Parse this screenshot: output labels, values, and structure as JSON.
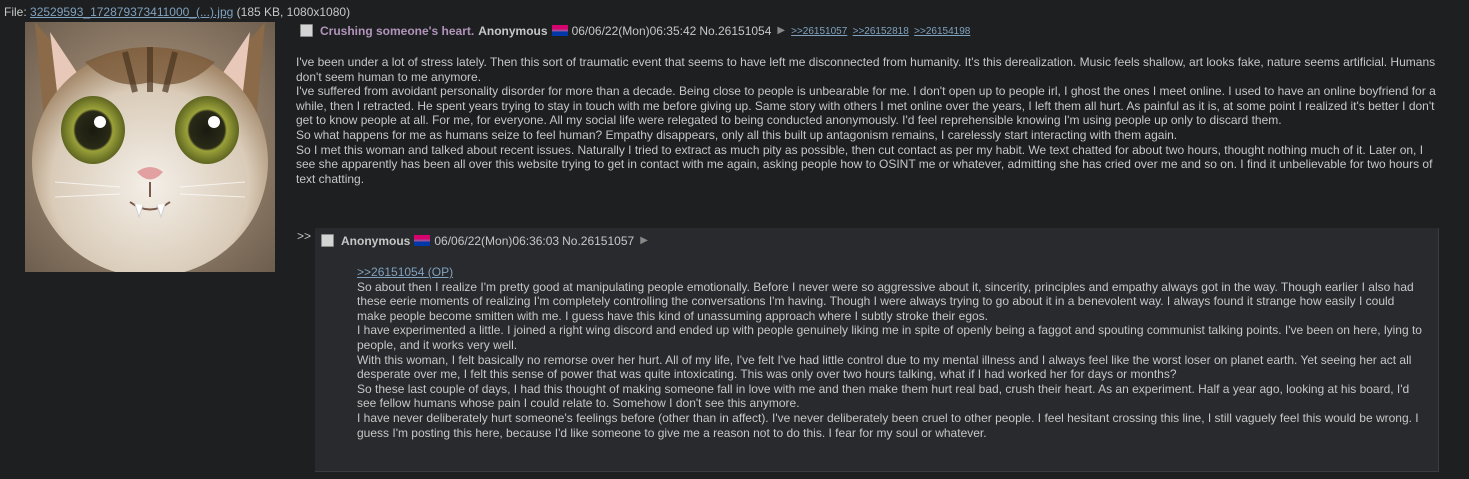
{
  "file": {
    "prefix": "File: ",
    "filename": "32529593_172879373411000_(...).jpg",
    "info": " (185 KB, 1080x1080)"
  },
  "colors": {
    "background": "#1d1f21",
    "reply_bg": "#282a2e",
    "subject": "#b294bb",
    "link": "#81a2be",
    "text": "#c5c8c6"
  },
  "op": {
    "subject": "Crushing someone's heart.",
    "name": "Anonymous",
    "flag_icon": "bisexual-flag-icon",
    "datetime": "06/06/22(Mon)06:35:42",
    "post_no": "No.26151054",
    "menu_icon": "triangle-right-icon",
    "backlinks": [
      ">>26151057",
      ">>26152818",
      ">>26154198"
    ],
    "body": [
      "I've been under a lot of stress lately. Then this sort of traumatic event that seems to have left me disconnected from humanity. It's this derealization. Music feels shallow, art looks fake, nature seems artificial. Humans don't seem human to me anymore.",
      "I've suffered from avoidant personality disorder for more than a decade. Being close to people is unbearable for me. I don't open up to people irl, I ghost the ones I meet online. I used to have an online boyfriend for a while, then I retracted. He spent years trying to stay in touch with me before giving up. Same story with others I met online over the years, I left them all hurt. As painful as it is, at some point I realized it's better I don't get to know people at all. For me, for everyone. All my social life were relegated to being conducted anonymously. I'd feel reprehensible knowing I'm using people up only to discard them.",
      "So what happens for me as humans seize to feel human? Empathy disappears, only all this built up antagonism remains, I carelessly start interacting with them again.",
      "So I met this woman and talked about recent issues. Naturally I tried to extract as much pity as possible, then cut contact as per my habit. We text chatted for about two hours, thought nothing much of it. Later on, I see she apparently has been all over this website trying to get in contact with me again, asking people how to OSINT me or whatever, admitting she has cried over me and so on. I find it unbelievable for two hours of text chatting."
    ]
  },
  "reply": {
    "arrows": ">>",
    "name": "Anonymous",
    "flag_icon": "bisexual-flag-icon",
    "datetime": "06/06/22(Mon)06:36:03",
    "post_no": "No.26151057",
    "menu_icon": "triangle-right-icon",
    "quotelink": ">>26151054 (OP)",
    "body": [
      "So about then I realize I'm pretty good at manipulating people emotionally. Before I never were so aggressive about it, sincerity, principles and empathy always got in the way. Though earlier I also had these eerie moments of realizing I'm completely controlling the conversations I'm having. Though I were always trying to go about it in a benevolent way. I always found it strange how easily I could make people become smitten with me. I guess have this kind of unassuming approach where I subtly stroke their egos.",
      "I have experimented a little. I joined a right wing discord and ended up with people genuinely liking me in spite of openly being a faggot and spouting communist talking points. I've been on here, lying to people, and it works very well.",
      "With this woman, I felt basically no remorse over her hurt. All of my life, I've felt I've had little control due to my mental illness and I always feel like the worst loser on planet earth. Yet seeing her act all desperate over me, I felt this sense of power that was quite intoxicating. This was only over two hours talking, what if I had worked her for days or months?",
      "So these last couple of days, I had this thought of making someone fall in love with me and then make them hurt real bad, crush their heart. As an experiment. Half a year ago, looking at his board, I'd see fellow humans whose pain I could relate to. Somehow I don't see this anymore.",
      "I have never deliberately hurt someone's feelings before (other than in affect). I've never deliberately been cruel to other people. I feel hesitant crossing this line, I still vaguely feel this would be wrong. I guess I'm posting this here, because I'd like someone to give me a reason not to do this. I fear for my soul or whatever."
    ]
  }
}
